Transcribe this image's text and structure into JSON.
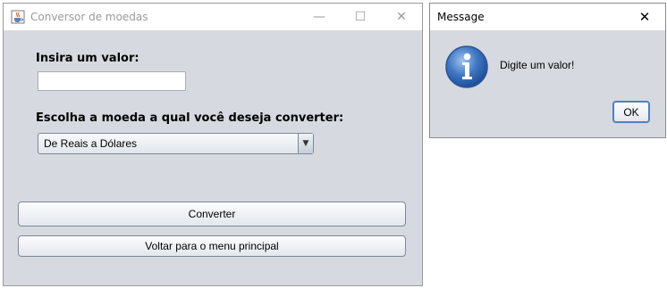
{
  "main_window": {
    "title": "Conversor de moedas",
    "minimize_glyph": "—",
    "maximize_glyph": "☐",
    "close_glyph": "✕",
    "value_label": "Insira um valor:",
    "value_input": "",
    "currency_label": "Escolha a moeda a qual você deseja converter:",
    "currency_selected": "De Reais a Dólares",
    "dropdown_arrow": "▼",
    "convert_button": "Converter",
    "back_button": "Voltar para o menu principal"
  },
  "message_dialog": {
    "title": "Message",
    "close_glyph": "✕",
    "text": "Digite um valor!",
    "ok_button": "OK"
  },
  "icons": {
    "app": "java-cup-icon",
    "info": "info-icon"
  },
  "colors": {
    "window_bg": "#d6d9df",
    "focus_border": "#4f81bd"
  }
}
